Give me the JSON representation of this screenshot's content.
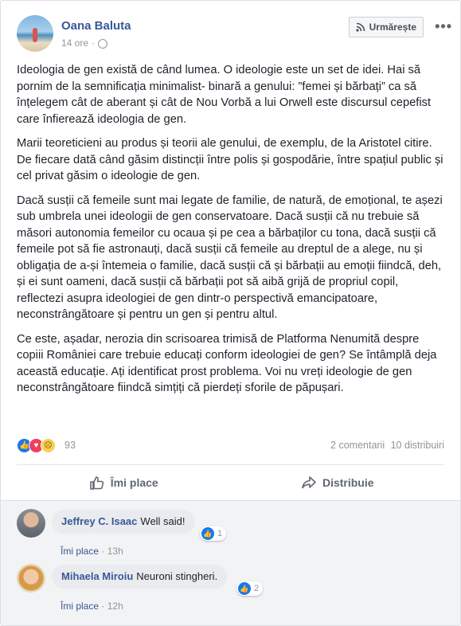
{
  "post": {
    "author": "Oana Baluta",
    "time": "14 ore",
    "separator": "·",
    "follow_label": "Urmărește",
    "more_label": "•••",
    "paragraphs": [
      "Ideologia de gen există de când lumea. O ideologie este un set de idei. Hai să pornim de la semnificația minimalist- binară a genului: ”femei și bărbați” ca să înțelegem cât de aberant și cât de Nou Vorbă a lui Orwell este discursul cepefist care înfierează ideologia de gen.",
      "Marii teoreticieni au produs și teorii ale genului, de exemplu, de la Aristotel citire. De fiecare dată când găsim distincții între polis și gospodărie, între spațiul public și cel privat găsim o ideologie de gen.",
      "Dacă susții că femeile sunt mai legate de familie, de natură, de emoțional, te așezi sub umbrela unei ideologii de gen conservatoare. Dacă susții că nu trebuie să măsori autonomia femeilor cu ocaua și pe cea a bărbaților cu tona, dacă susții că femeile pot să fie astronauți, dacă susții că femeile au dreptul de a alege, nu și obligația de a-și întemeia o familie, dacă susții că și bărbații au emoții fiindcă, deh, și ei sunt oameni, dacă susții că bărbații pot să aibă grijă de propriul copil, reflectezi asupra ideologiei de gen dintr-o perspectivă emancipatoare, neconstrângătoare și pentru un gen și pentru altul.",
      "Ce este, așadar, nerozia din scrisoarea trimisă de Platforma Nenumită despre copiii României care trebuie educați conform ideologiei de gen? Se întâmplă deja această educație. Ați identificat prost problema. Voi nu vreți ideologie de gen neconstrângătoare fiindcă simțiți că pierdeți sforile de păpușari."
    ],
    "reactions_count": "93",
    "comments_count": "2 comentarii",
    "shares_count": "10 distribuiri",
    "like_action": "Îmi place",
    "share_action": "Distribuie"
  },
  "comments": [
    {
      "name": "Jeffrey C. Isaac",
      "text": "Well said!",
      "reactions": "1",
      "like_label": "Îmi place",
      "time": "13h"
    },
    {
      "name": "Mihaela Miroiu",
      "text": "Neuroni stingheri.",
      "reactions": "2",
      "like_label": "Îmi place",
      "time": "12h"
    }
  ],
  "icons": {
    "follow": "rss-icon",
    "privacy": "globe-icon",
    "like_action": "thumbs-up-icon",
    "share_action": "share-arrow-icon"
  },
  "colors": {
    "link": "#365899",
    "muted": "#90949c",
    "like": "#1877f2",
    "love": "#f33e58",
    "sad": "#f7d154"
  }
}
